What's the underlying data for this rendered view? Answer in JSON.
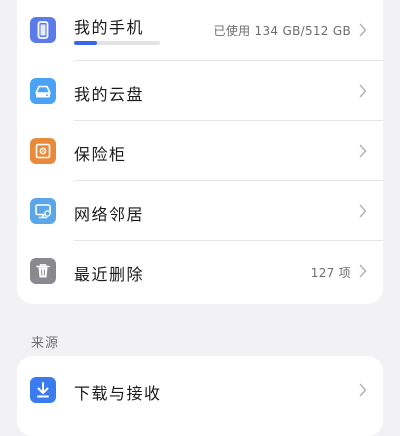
{
  "storage": {
    "items": [
      {
        "label": "我的手机",
        "value": "已使用 134 GB/512 GB",
        "icon": "phone-icon",
        "color": "#5b7be8",
        "usage_fraction": 0.262
      },
      {
        "label": "我的云盘",
        "value": "",
        "icon": "cloud-drive-icon",
        "color": "#4aa3f5"
      },
      {
        "label": "保险柜",
        "value": "",
        "icon": "safe-icon",
        "color": "#e98a3a"
      },
      {
        "label": "网络邻居",
        "value": "",
        "icon": "network-neighbor-icon",
        "color": "#5aa6e6"
      },
      {
        "label": "最近删除",
        "value": "127 项",
        "icon": "trash-icon",
        "color": "#8a8a8e"
      }
    ]
  },
  "sources": {
    "title": "来源",
    "items": [
      {
        "label": "下载与接收",
        "icon": "download-icon",
        "color": "#3a7bf0"
      }
    ]
  }
}
